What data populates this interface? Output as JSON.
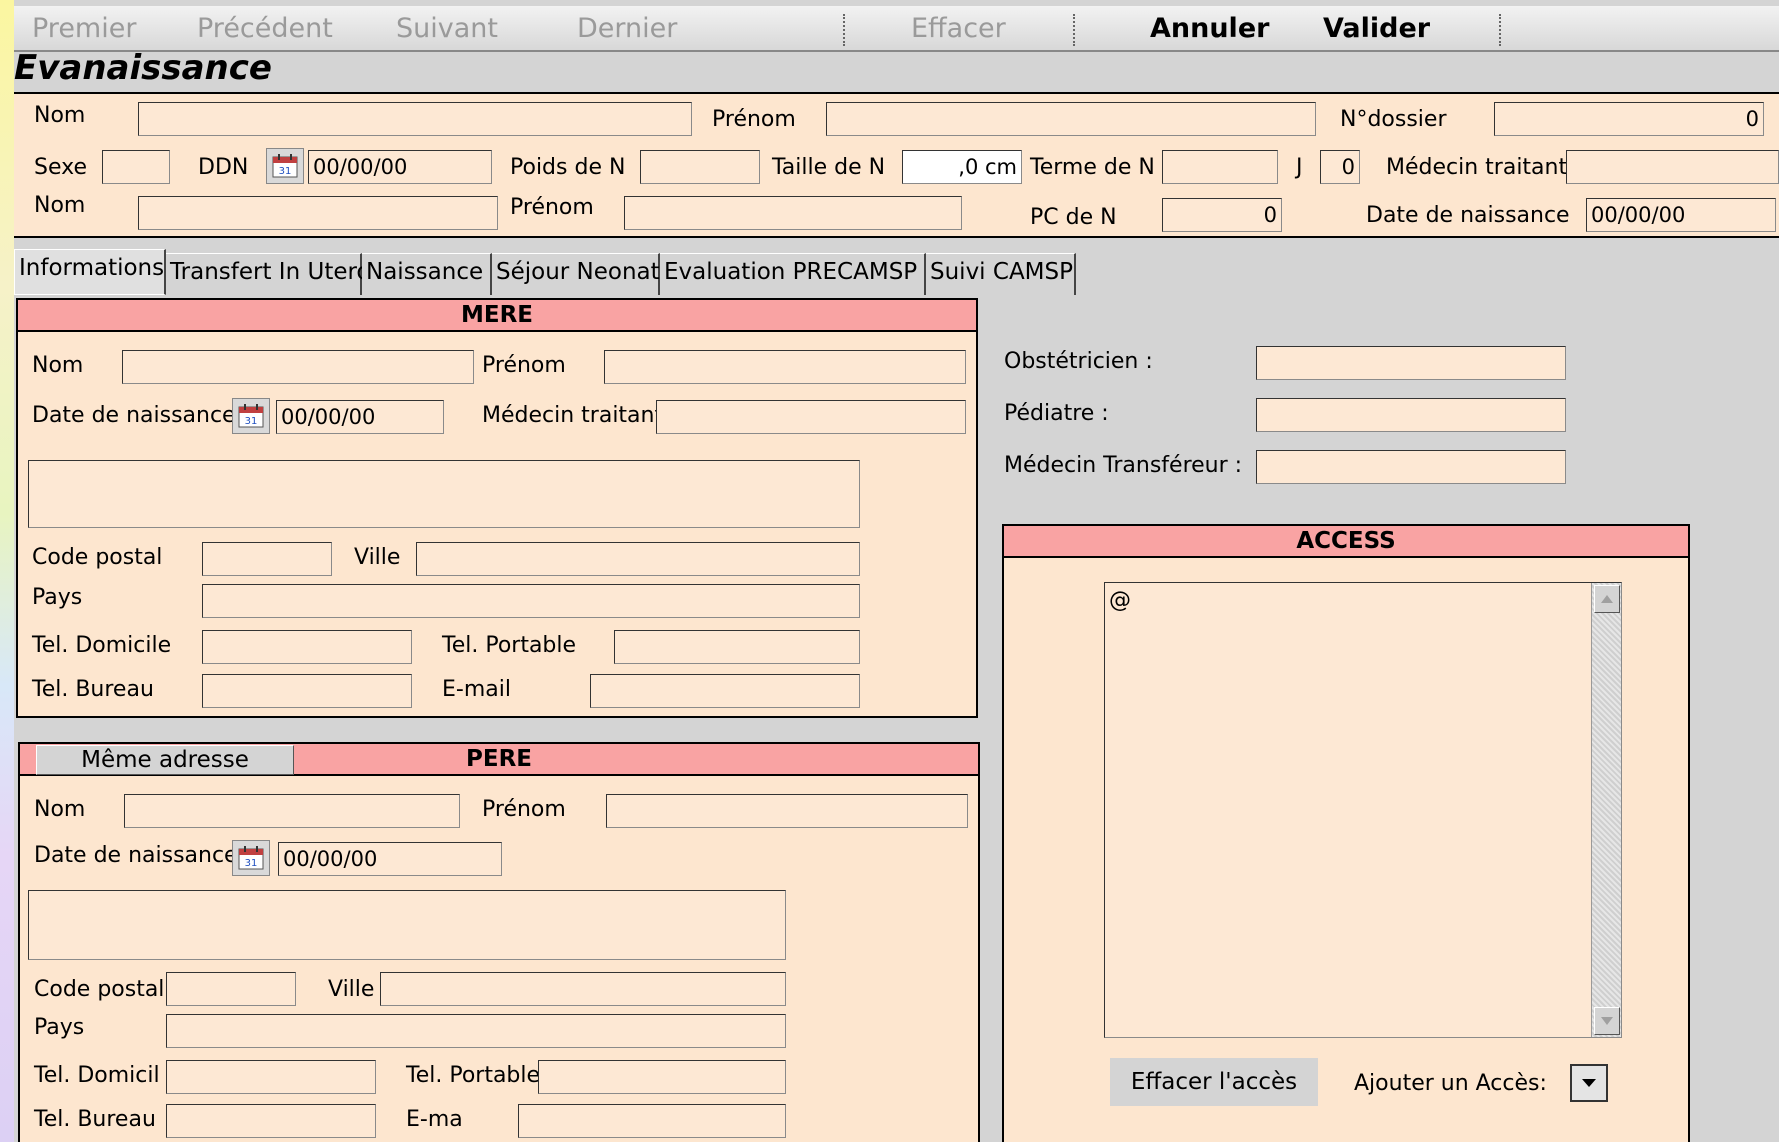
{
  "toolbar": {
    "first": "Premier",
    "previous": "Précédent",
    "next": "Suivant",
    "last": "Dernier",
    "clear": "Effacer",
    "cancel": "Annuler",
    "validate": "Valider"
  },
  "app_title": "Evanaissance",
  "header": {
    "nom_label": "Nom",
    "nom_value": "",
    "prenom_label": "Prénom",
    "prenom_value": "",
    "dossier_label": "N°dossier",
    "dossier_value": "0",
    "sexe_label": "Sexe",
    "sexe_value": "",
    "ddn_label": "DDN",
    "ddn_value": "00/00/00",
    "poids_label": "Poids de N",
    "poids_value": "",
    "taille_label": "Taille de N",
    "taille_value": ",0 cm",
    "terme_label": "Terme de N",
    "terme_value": "",
    "j_label": "J",
    "j_value": "0",
    "medecin_label": "Médecin traitant",
    "medecin_value": "",
    "nom2_label": "Nom",
    "nom2_value": "",
    "prenom2_label": "Prénom",
    "prenom2_value": "",
    "pc_label": "PC  de N",
    "pc_value": "0",
    "date_naissance_label": "Date de naissance",
    "date_naissance_value": "00/00/00"
  },
  "tabs": [
    {
      "label": "Informations"
    },
    {
      "label": "Transfert In Utero"
    },
    {
      "label": "Naissance"
    },
    {
      "label": "Séjour Neonat"
    },
    {
      "label": "Evaluation PRECAMSP"
    },
    {
      "label": "Suivi CAMSP"
    }
  ],
  "mere": {
    "title": "MERE",
    "nom_label": "Nom",
    "prenom_label": "Prénom",
    "dob_label": "Date de naissance",
    "dob_value": "00/00/00",
    "medecin_label": "Médecin traitant",
    "cp_label": "Code postal",
    "ville_label": "Ville",
    "pays_label": "Pays",
    "tel_dom_label": "Tel. Domicile",
    "tel_port_label": "Tel. Portable",
    "tel_bur_label": "Tel. Bureau",
    "email_label": "E-mail"
  },
  "pere": {
    "title": "PERE",
    "same_address_button": "Même adresse",
    "nom_label": "Nom",
    "prenom_label": "Prénom",
    "dob_label": "Date de naissance",
    "dob_value": "00/00/00",
    "cp_label": "Code postal",
    "ville_label": "Ville",
    "pays_label": "Pays",
    "tel_dom_label": "Tel. Domicil",
    "tel_port_label": "Tel. Portable",
    "tel_bur_label": "Tel. Bureau",
    "email_label": "E-ma"
  },
  "doctors": {
    "obstetricien_label": "Obstétricien :",
    "pediatre_label": "Pédiatre :",
    "transfereur_label": "Médecin Transféreur :"
  },
  "access": {
    "title": "ACCESS",
    "list_value": "@",
    "clear_button": "Effacer l'accès",
    "add_label": "Ajouter un Accès:"
  }
}
